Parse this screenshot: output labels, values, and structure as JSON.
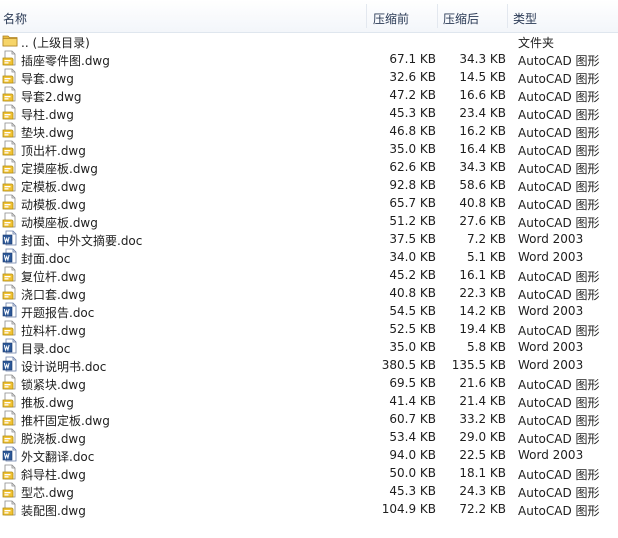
{
  "columns": {
    "name": "名称",
    "original": "压缩前",
    "compressed": "压缩后",
    "type": "类型"
  },
  "rows": [
    {
      "icon": "folder-up-icon",
      "name": ".. (上级目录)",
      "original": "",
      "compressed": "",
      "type": "文件夹"
    },
    {
      "icon": "dwg-file-icon",
      "name": "插座零件图.dwg",
      "original": "67.1 KB",
      "compressed": "34.3 KB",
      "type": "AutoCAD 图形"
    },
    {
      "icon": "dwg-file-icon",
      "name": "导套.dwg",
      "original": "32.6 KB",
      "compressed": "14.5 KB",
      "type": "AutoCAD 图形"
    },
    {
      "icon": "dwg-file-icon",
      "name": "导套2.dwg",
      "original": "47.2 KB",
      "compressed": "16.6 KB",
      "type": "AutoCAD 图形"
    },
    {
      "icon": "dwg-file-icon",
      "name": "导柱.dwg",
      "original": "45.3 KB",
      "compressed": "23.4 KB",
      "type": "AutoCAD 图形"
    },
    {
      "icon": "dwg-file-icon",
      "name": "垫块.dwg",
      "original": "46.8 KB",
      "compressed": "16.2 KB",
      "type": "AutoCAD 图形"
    },
    {
      "icon": "dwg-file-icon",
      "name": "顶出杆.dwg",
      "original": "35.0 KB",
      "compressed": "16.4 KB",
      "type": "AutoCAD 图形"
    },
    {
      "icon": "dwg-file-icon",
      "name": "定摸座板.dwg",
      "original": "62.6 KB",
      "compressed": "34.3 KB",
      "type": "AutoCAD 图形"
    },
    {
      "icon": "dwg-file-icon",
      "name": "定模板.dwg",
      "original": "92.8 KB",
      "compressed": "58.6 KB",
      "type": "AutoCAD 图形"
    },
    {
      "icon": "dwg-file-icon",
      "name": "动模板.dwg",
      "original": "65.7 KB",
      "compressed": "40.8 KB",
      "type": "AutoCAD 图形"
    },
    {
      "icon": "dwg-file-icon",
      "name": "动模座板.dwg",
      "original": "51.2 KB",
      "compressed": "27.6 KB",
      "type": "AutoCAD 图形"
    },
    {
      "icon": "doc-file-icon",
      "name": "封面、中外文摘要.doc",
      "original": "37.5 KB",
      "compressed": "7.2 KB",
      "type": "Word 2003"
    },
    {
      "icon": "doc-file-icon",
      "name": "封面.doc",
      "original": "34.0 KB",
      "compressed": "5.1 KB",
      "type": "Word 2003"
    },
    {
      "icon": "dwg-file-icon",
      "name": "复位杆.dwg",
      "original": "45.2 KB",
      "compressed": "16.1 KB",
      "type": "AutoCAD 图形"
    },
    {
      "icon": "dwg-file-icon",
      "name": "浇口套.dwg",
      "original": "40.8 KB",
      "compressed": "22.3 KB",
      "type": "AutoCAD 图形"
    },
    {
      "icon": "doc-file-icon",
      "name": "开题报告.doc",
      "original": "54.5 KB",
      "compressed": "14.2 KB",
      "type": "Word 2003"
    },
    {
      "icon": "dwg-file-icon",
      "name": "拉料杆.dwg",
      "original": "52.5 KB",
      "compressed": "19.4 KB",
      "type": "AutoCAD 图形"
    },
    {
      "icon": "doc-file-icon",
      "name": "目录.doc",
      "original": "35.0 KB",
      "compressed": "5.8 KB",
      "type": "Word 2003"
    },
    {
      "icon": "doc-file-icon",
      "name": "设计说明书.doc",
      "original": "380.5 KB",
      "compressed": "135.5 KB",
      "type": "Word 2003"
    },
    {
      "icon": "dwg-file-icon",
      "name": "锁紧块.dwg",
      "original": "69.5 KB",
      "compressed": "21.6 KB",
      "type": "AutoCAD 图形"
    },
    {
      "icon": "dwg-file-icon",
      "name": "推板.dwg",
      "original": "41.4 KB",
      "compressed": "21.4 KB",
      "type": "AutoCAD 图形"
    },
    {
      "icon": "dwg-file-icon",
      "name": "推杆固定板.dwg",
      "original": "60.7 KB",
      "compressed": "33.2 KB",
      "type": "AutoCAD 图形"
    },
    {
      "icon": "dwg-file-icon",
      "name": "脱浇板.dwg",
      "original": "53.4 KB",
      "compressed": "29.0 KB",
      "type": "AutoCAD 图形"
    },
    {
      "icon": "doc-file-icon",
      "name": "外文翻译.doc",
      "original": "94.0 KB",
      "compressed": "22.5 KB",
      "type": "Word 2003"
    },
    {
      "icon": "dwg-file-icon",
      "name": "斜导柱.dwg",
      "original": "50.0 KB",
      "compressed": "18.1 KB",
      "type": "AutoCAD 图形"
    },
    {
      "icon": "dwg-file-icon",
      "name": "型芯.dwg",
      "original": "45.3 KB",
      "compressed": "24.3 KB",
      "type": "AutoCAD 图形"
    },
    {
      "icon": "dwg-file-icon",
      "name": "装配图.dwg",
      "original": "104.9 KB",
      "compressed": "72.2 KB",
      "type": "AutoCAD 图形"
    }
  ]
}
